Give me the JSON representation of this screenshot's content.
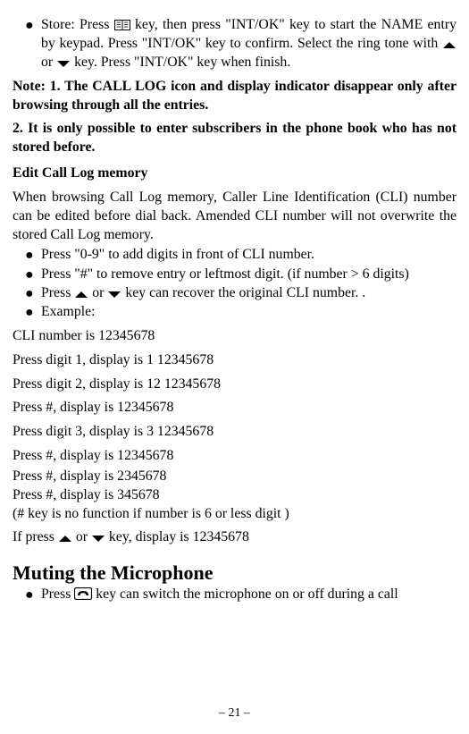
{
  "top_bullet": {
    "text_parts": {
      "a": "Store: Press ",
      "b": " key, then press \"INT/OK\" key to start the NAME entry by keypad. Press \"INT/OK\" key to confirm. Select the ring tone with ",
      "c": " or ",
      "d": " key. Press \"INT/OK\" key when finish."
    }
  },
  "note1_line1": "Note: 1. The CALL LOG icon and display indicator disappear only after browsing through all the entries.",
  "note2_text": "2. It is only possible to enter subscribers in the phone book who has not stored before.",
  "edit_head": "Edit Call Log memory",
  "edit_para": "When browsing Call Log memory, Caller Line Identification (CLI) number can be edited before dial back. Amended CLI number will not overwrite the stored Call Log memory.",
  "edit_bullets": {
    "b1": "Press \"0-9\" to add digits in front of CLI number.",
    "b2": "Press \"#\" to remove entry or leftmost digit. (if number > 6 digits)",
    "b3a": "Press ",
    "b3b": " or ",
    "b3c": " key can recover the original CLI number.      .",
    "b4": "Example:"
  },
  "ex": {
    "l1": "CLI number is 12345678",
    "l2": "Press digit 1, display is 1 12345678",
    "l3": "Press digit 2, display is 12 12345678",
    "l4": "Press #,        display is       12345678",
    "l5": "Press digit 3, display is 3 12345678",
    "l6": "Press #,      display is      12345678",
    "l7": "Press #,      display is       2345678",
    "l8": "Press #,      display is         345678",
    "l9": "(# key is no function if number is 6 or less digit )",
    "l10a": "If press ",
    "l10b": " or ",
    "l10c": " key, display is 12345678"
  },
  "mute_head": "Muting the Microphone",
  "mute_bullet_a": "Press ",
  "mute_bullet_b": " key can switch the microphone on or off during a call",
  "page_num": "– 21 –"
}
